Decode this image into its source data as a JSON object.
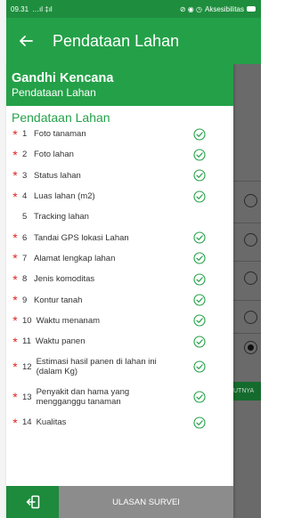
{
  "status_bar": {
    "time": "09.31",
    "signal": "…ıl ‡ıl",
    "accessibility": "Aksesibilitas"
  },
  "app_bar": {
    "back_icon": "arrow-left-icon",
    "title": "Pendataan Lahan"
  },
  "drawer": {
    "title": "Gandhi Kencana",
    "subtitle": "Pendataan Lahan",
    "section_title": "Pendataan Lahan",
    "items": [
      {
        "num": "1",
        "label": "Foto tanaman",
        "required": true,
        "done": true
      },
      {
        "num": "2",
        "label": "Foto lahan",
        "required": true,
        "done": true
      },
      {
        "num": "3",
        "label": "Status lahan",
        "required": true,
        "done": true
      },
      {
        "num": "4",
        "label": "Luas lahan (m2)",
        "required": true,
        "done": true
      },
      {
        "num": "5",
        "label": "Tracking lahan",
        "required": false,
        "done": false
      },
      {
        "num": "6",
        "label": "Tandai GPS lokasi Lahan",
        "required": true,
        "done": true
      },
      {
        "num": "7",
        "label": "Alamat lengkap lahan",
        "required": true,
        "done": true
      },
      {
        "num": "8",
        "label": "Jenis komoditas",
        "required": true,
        "done": true
      },
      {
        "num": "9",
        "label": "Kontur tanah",
        "required": true,
        "done": true
      },
      {
        "num": "10",
        "label": "Waktu menanam",
        "required": true,
        "done": true
      },
      {
        "num": "11",
        "label": "Waktu panen",
        "required": true,
        "done": true
      },
      {
        "num": "12",
        "label": "Estimasi hasil panen di lahan ini (dalam Kg)",
        "required": true,
        "done": true
      },
      {
        "num": "13",
        "label": "Penyakit dan hama yang mengganggu tanaman",
        "required": true,
        "done": true
      },
      {
        "num": "14",
        "label": "Kualitas",
        "required": true,
        "done": true
      }
    ],
    "required_mark": "*",
    "check_icon": "check-circle-icon",
    "bottom": {
      "logout_icon": "logout-icon",
      "review_label": "ULASAN SURVEI"
    }
  },
  "background": {
    "next_label": "UTNYA"
  },
  "colors": {
    "primary": "#24a148",
    "primary_dark": "#1e8e3e",
    "required": "#e02424",
    "check": "#24a148",
    "review_button": "#8c8c8c"
  }
}
